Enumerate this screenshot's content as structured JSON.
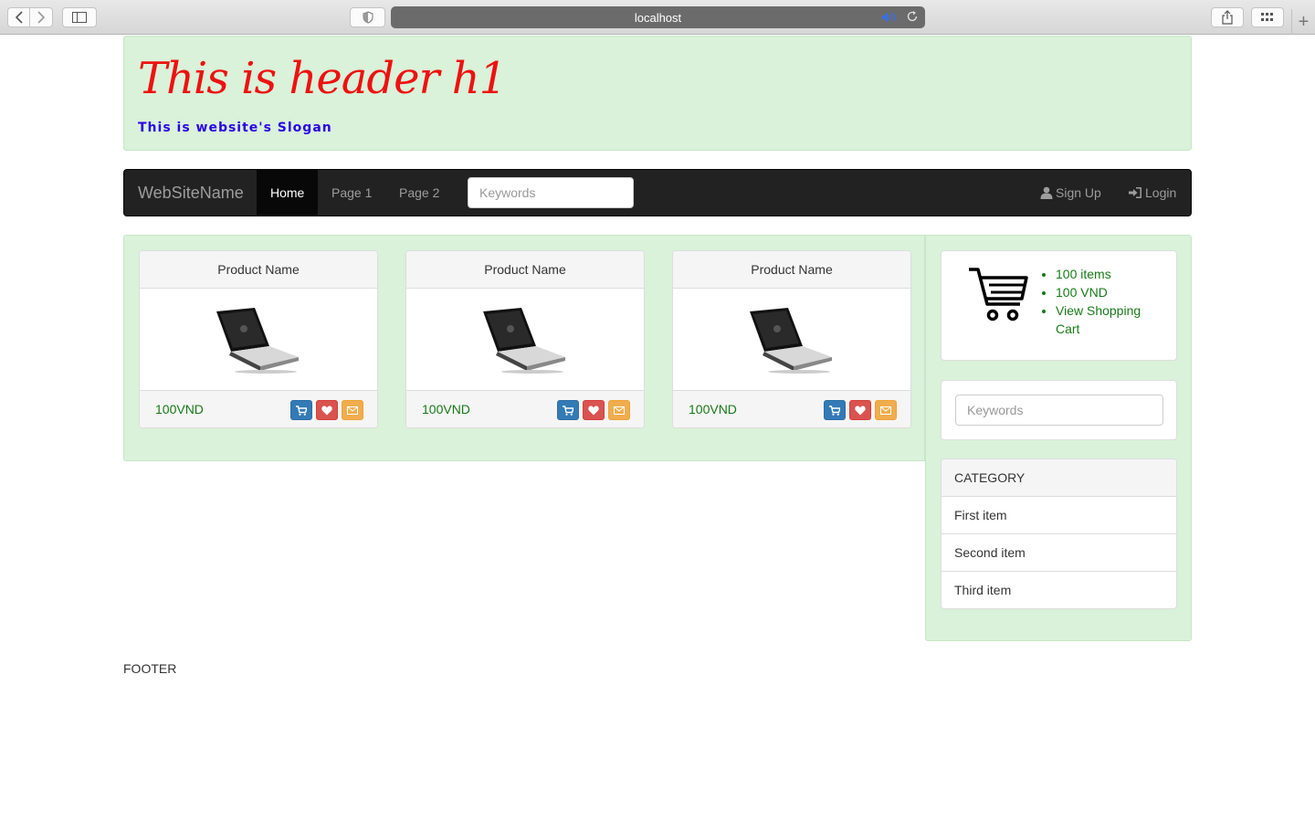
{
  "browser": {
    "url": "localhost"
  },
  "header": {
    "title": "This is header h1",
    "slogan": "This is website's Slogan"
  },
  "navbar": {
    "brand": "WebSiteName",
    "links": [
      "Home",
      "Page 1",
      "Page 2"
    ],
    "search_placeholder": "Keywords",
    "signup": "Sign Up",
    "login": "Login"
  },
  "products": [
    {
      "name": "Product Name",
      "price": "100VND"
    },
    {
      "name": "Product Name",
      "price": "100VND"
    },
    {
      "name": "Product Name",
      "price": "100VND"
    }
  ],
  "cart": {
    "items": [
      "100 items",
      "100 VND",
      "View Shopping Cart"
    ]
  },
  "sidebar": {
    "search_placeholder": "Keywords",
    "category_title": "CATEGORY",
    "categories": [
      "First item",
      "Second item",
      "Third item"
    ]
  },
  "footer": {
    "text": "FOOTER"
  },
  "colors": {
    "panel_bg": "#d9f2d9",
    "title": "#ee1111",
    "slogan": "#2b00e8",
    "price": "#177a17"
  }
}
